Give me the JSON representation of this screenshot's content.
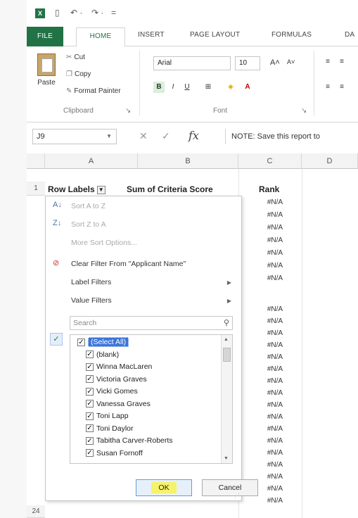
{
  "qat": {
    "excel_logo": "X",
    "save_glyph": "▯",
    "undo_glyph": "↶ ·",
    "redo_glyph": "↷ ·",
    "customize_glyph": "="
  },
  "ribbon_tabs": [
    "FILE",
    "HOME",
    "INSERT",
    "PAGE LAYOUT",
    "FORMULAS",
    "DA"
  ],
  "clipboard": {
    "paste_label": "Paste",
    "cut_label": "Cut",
    "copy_label": "Copy",
    "format_painter_label": "Format Painter",
    "group_label": "Clipboard"
  },
  "font": {
    "name": "Arial",
    "size": "10",
    "bold": "B",
    "italic": "I",
    "underline": "U",
    "group_label": "Font"
  },
  "formula_bar": {
    "name_box": "J9",
    "fx": "fx",
    "formula": "NOTE: Save this report to"
  },
  "columns": [
    "A",
    "B",
    "C",
    "D"
  ],
  "header_row": {
    "row_number": "1",
    "a": "Row Labels",
    "b": "Sum of Criteria Score",
    "c": "Rank"
  },
  "na_value": "#N/A",
  "last_row_number": "24",
  "dropdown": {
    "sort_a_to_z": "Sort A to Z",
    "sort_z_to_a": "Sort Z to A",
    "more_sort": "More Sort Options...",
    "clear_filter": "Clear Filter From \"Applicant Name\"",
    "label_filters": "Label Filters",
    "value_filters": "Value Filters",
    "search_placeholder": "Search",
    "items": [
      "(Select All)",
      "(blank)",
      "Winna MacLaren",
      "Victoria Graves",
      "Vicki Gomes",
      "Vanessa Graves",
      "Toni Lapp",
      "Toni Daylor",
      "Tabitha Carver-Roberts",
      "Susan Fornoff"
    ],
    "ok_label": "OK",
    "cancel_label": "Cancel"
  },
  "colors": {
    "excel_green": "#217346",
    "highlight_yellow": "#f6f26a",
    "selection_blue": "#3b75d9"
  }
}
